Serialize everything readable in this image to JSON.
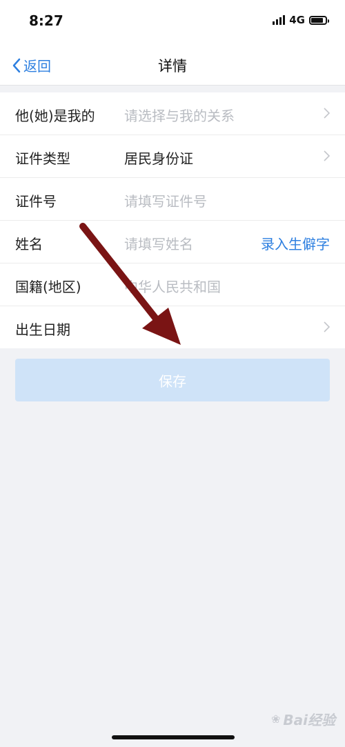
{
  "status_bar": {
    "time": "8:27",
    "network": "4G"
  },
  "nav": {
    "back_label": "返回",
    "title": "详情"
  },
  "form": {
    "rows": [
      {
        "label": "他(她)是我的",
        "value": "请选择与我的关系",
        "state": "placeholder",
        "trailing": "chevron"
      },
      {
        "label": "证件类型",
        "value": "居民身份证",
        "state": "filled",
        "trailing": "chevron"
      },
      {
        "label": "证件号",
        "value": "请填写证件号",
        "state": "placeholder",
        "trailing": ""
      },
      {
        "label": "姓名",
        "value": "请填写姓名",
        "state": "placeholder",
        "trailing": "action",
        "action_label": "录入生僻字"
      },
      {
        "label": "国籍(地区)",
        "value": "中华人民共和国",
        "state": "placeholder",
        "trailing": ""
      },
      {
        "label": "出生日期",
        "value": "",
        "state": "placeholder",
        "trailing": "chevron"
      }
    ]
  },
  "save_button": {
    "label": "保存"
  },
  "watermark": {
    "text": "Bai经验"
  },
  "colors": {
    "accent": "#2d7fe0",
    "button_bg": "#cfe3f8",
    "arrow": "#7a1414",
    "page_bg": "#f1f2f5"
  }
}
